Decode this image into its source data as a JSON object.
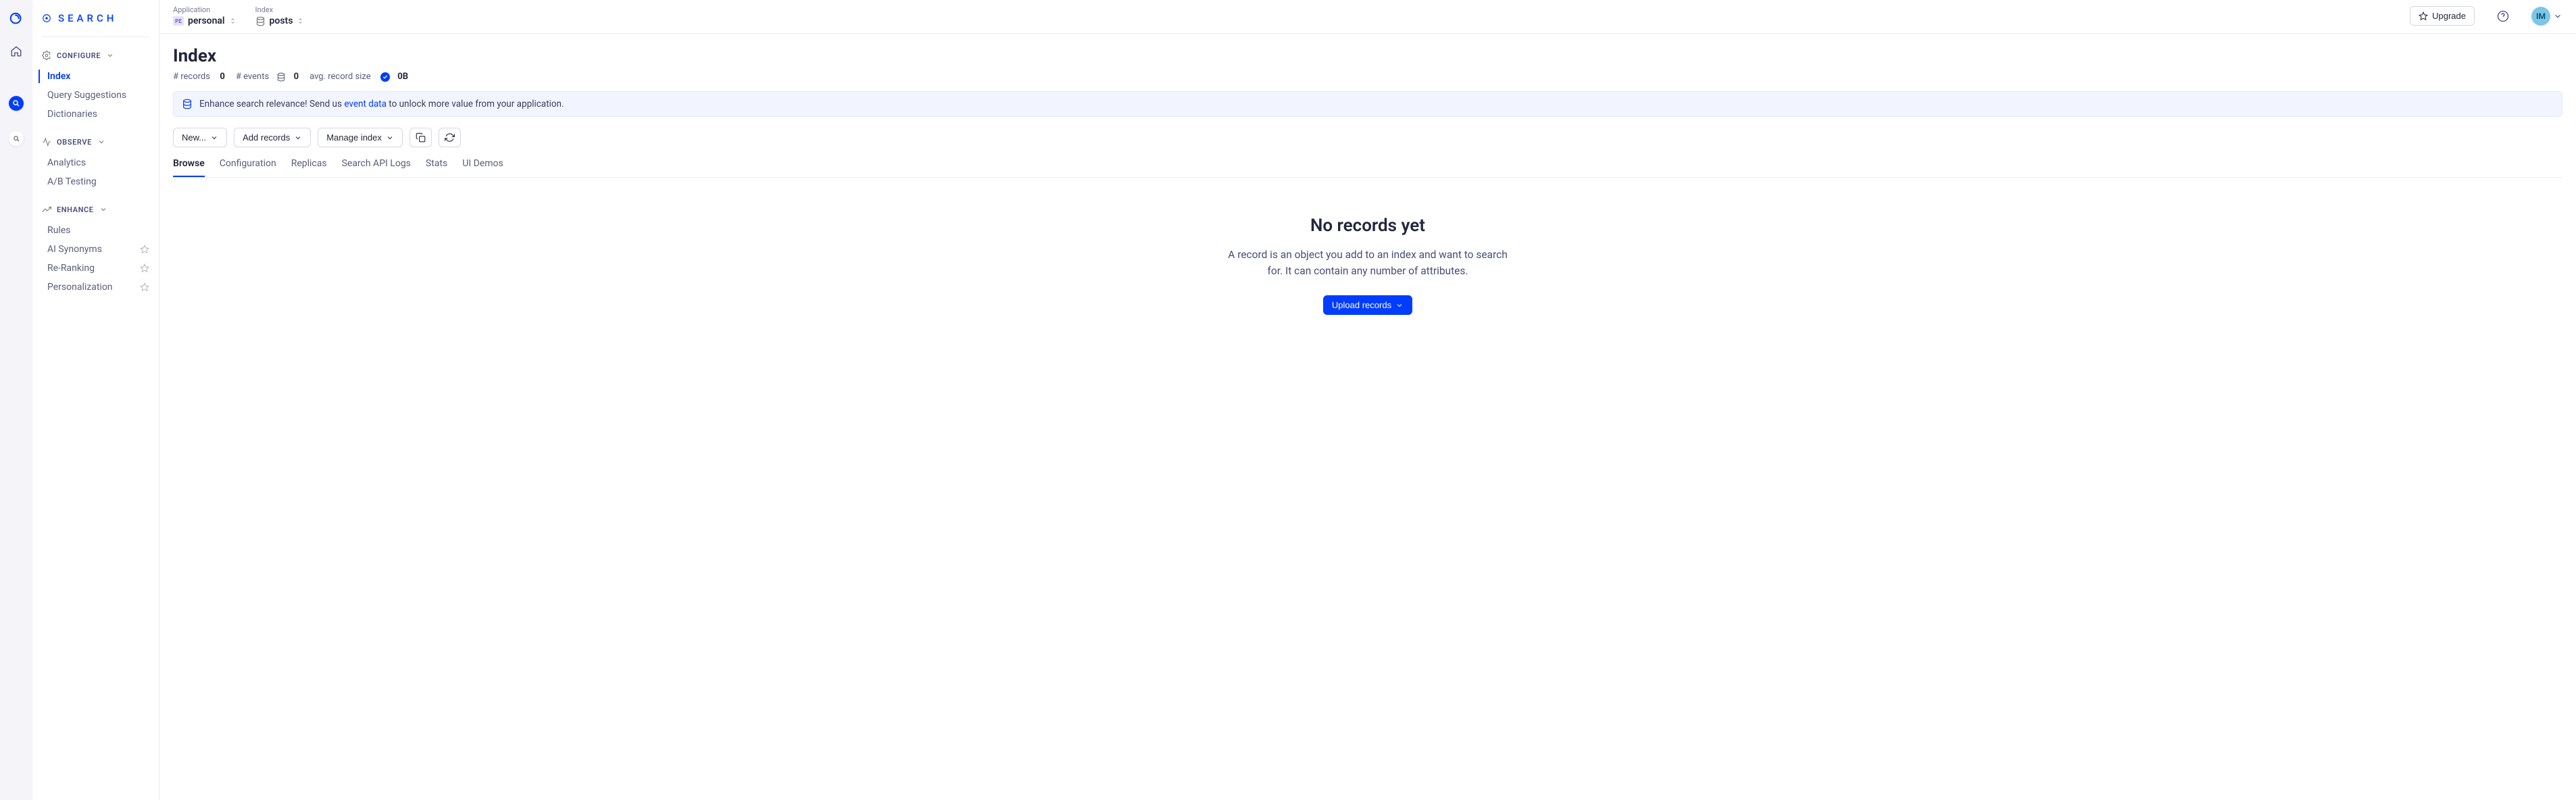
{
  "brand": {
    "title": "SEARCH"
  },
  "avatar": {
    "initials": "IM"
  },
  "topbar": {
    "application_label": "Application",
    "application_value": "personal",
    "application_badge": "PE",
    "index_label": "Index",
    "index_value": "posts",
    "upgrade": "Upgrade"
  },
  "sidebar": {
    "sections": {
      "configure": {
        "label": "CONFIGURE",
        "items": [
          "Index",
          "Query Suggestions",
          "Dictionaries"
        ]
      },
      "observe": {
        "label": "OBSERVE",
        "items": [
          "Analytics",
          "A/B Testing"
        ]
      },
      "enhance": {
        "label": "ENHANCE",
        "items": [
          "Rules",
          "AI Synonyms",
          "Re-Ranking",
          "Personalization"
        ]
      }
    }
  },
  "page": {
    "title": "Index",
    "stats": {
      "records_label": "# records",
      "records_value": "0",
      "events_label": "# events",
      "events_value": "0",
      "avg_label": "avg. record size",
      "avg_value": "0B"
    },
    "banner": {
      "prefix": "Enhance search relevance! Send us ",
      "link": "event data",
      "suffix": " to unlock more value from your application."
    },
    "actions": {
      "new": "New...",
      "add_records": "Add records",
      "manage_index": "Manage index"
    },
    "tabs": [
      "Browse",
      "Configuration",
      "Replicas",
      "Search API Logs",
      "Stats",
      "UI Demos"
    ],
    "empty": {
      "title": "No records yet",
      "body": "A record is an object you add to an index and want to search for. It can contain any number of attributes.",
      "cta": "Upload records"
    }
  }
}
